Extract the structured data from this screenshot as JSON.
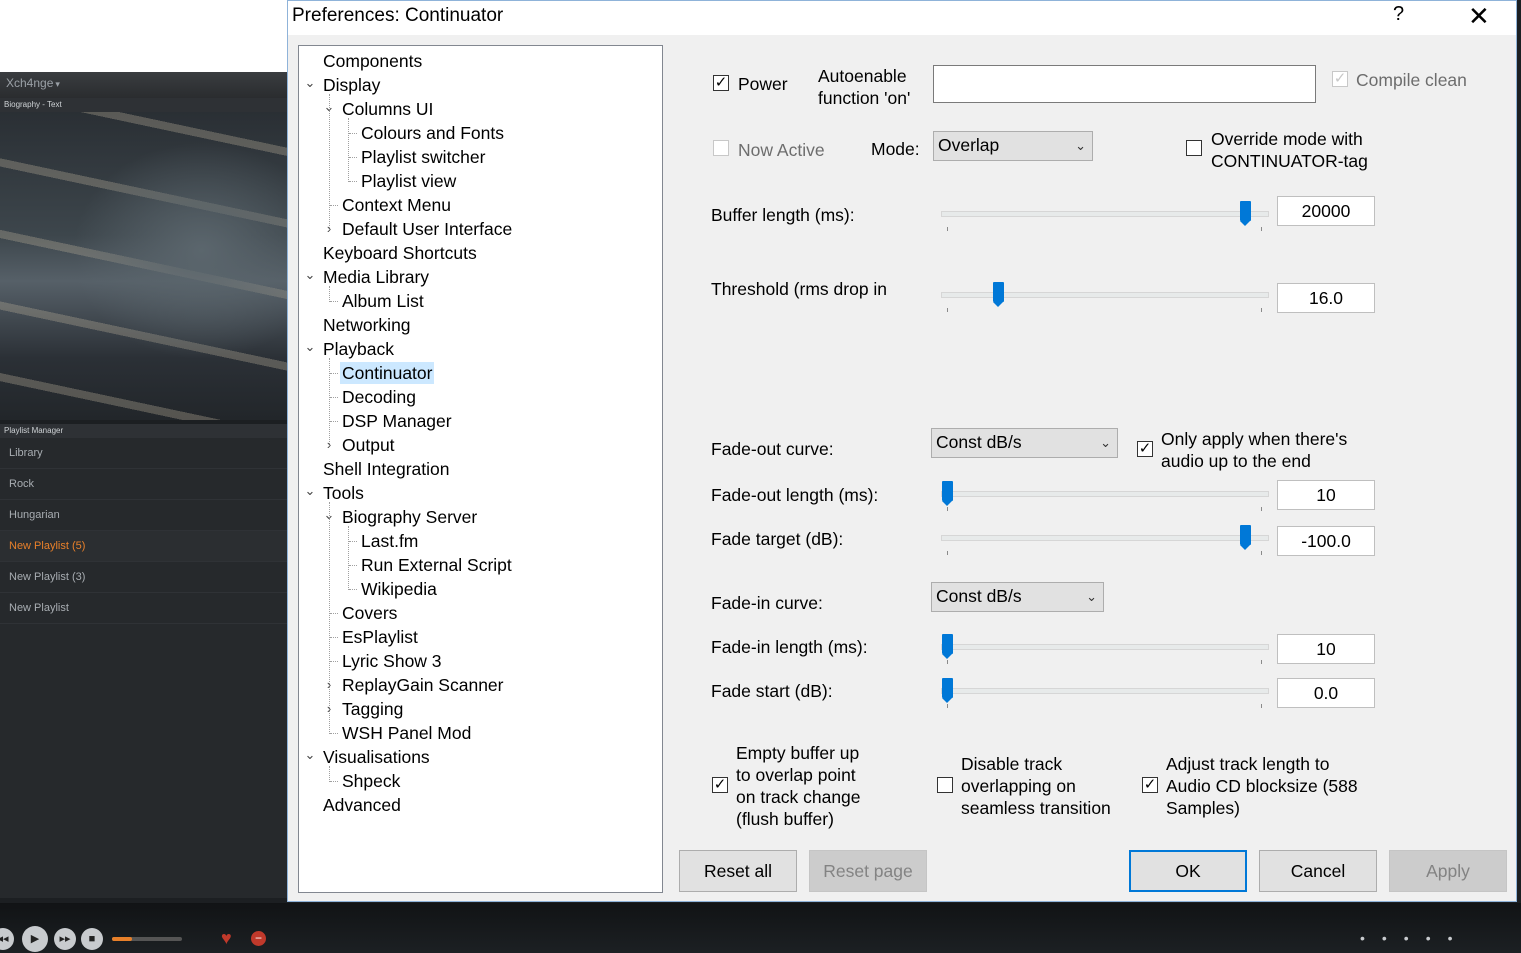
{
  "background": {
    "brand": "Xch4nge",
    "panel_header_top": "Biography - Text",
    "panel_header_mid": "Playlist Manager",
    "playlists": [
      {
        "label": "Library",
        "active": false
      },
      {
        "label": "Rock",
        "active": false
      },
      {
        "label": "Hungarian",
        "active": false
      },
      {
        "label": "New Playlist (5)",
        "active": true
      },
      {
        "label": "New Playlist (3)",
        "active": false
      },
      {
        "label": "New Playlist",
        "active": false
      }
    ],
    "accent": "#e8802a"
  },
  "dialog": {
    "title": "Preferences: Continuator",
    "help": "?",
    "close": "✕"
  },
  "tree": [
    {
      "label": "Components",
      "level": 0,
      "expander": ""
    },
    {
      "label": "Display",
      "level": 0,
      "expander": "open"
    },
    {
      "label": "Columns UI",
      "level": 1,
      "expander": "open"
    },
    {
      "label": "Colours and Fonts",
      "level": 2,
      "expander": ""
    },
    {
      "label": "Playlist switcher",
      "level": 2,
      "expander": ""
    },
    {
      "label": "Playlist view",
      "level": 2,
      "expander": ""
    },
    {
      "label": "Context Menu",
      "level": 1,
      "expander": ""
    },
    {
      "label": "Default User Interface",
      "level": 1,
      "expander": "closed"
    },
    {
      "label": "Keyboard Shortcuts",
      "level": 0,
      "expander": ""
    },
    {
      "label": "Media Library",
      "level": 0,
      "expander": "open"
    },
    {
      "label": "Album List",
      "level": 1,
      "expander": ""
    },
    {
      "label": "Networking",
      "level": 0,
      "expander": ""
    },
    {
      "label": "Playback",
      "level": 0,
      "expander": "open"
    },
    {
      "label": "Continuator",
      "level": 1,
      "expander": "",
      "selected": true
    },
    {
      "label": "Decoding",
      "level": 1,
      "expander": ""
    },
    {
      "label": "DSP Manager",
      "level": 1,
      "expander": ""
    },
    {
      "label": "Output",
      "level": 1,
      "expander": "closed"
    },
    {
      "label": "Shell Integration",
      "level": 0,
      "expander": ""
    },
    {
      "label": "Tools",
      "level": 0,
      "expander": "open"
    },
    {
      "label": "Biography Server",
      "level": 1,
      "expander": "open"
    },
    {
      "label": "Last.fm",
      "level": 2,
      "expander": ""
    },
    {
      "label": "Run External Script",
      "level": 2,
      "expander": ""
    },
    {
      "label": "Wikipedia",
      "level": 2,
      "expander": ""
    },
    {
      "label": "Covers",
      "level": 1,
      "expander": ""
    },
    {
      "label": "EsPlaylist",
      "level": 1,
      "expander": ""
    },
    {
      "label": "Lyric Show 3",
      "level": 1,
      "expander": ""
    },
    {
      "label": "ReplayGain Scanner",
      "level": 1,
      "expander": "closed"
    },
    {
      "label": "Tagging",
      "level": 1,
      "expander": "closed"
    },
    {
      "label": "WSH Panel Mod",
      "level": 1,
      "expander": ""
    },
    {
      "label": "Visualisations",
      "level": 0,
      "expander": "open"
    },
    {
      "label": "Shpeck",
      "level": 1,
      "expander": ""
    },
    {
      "label": "Advanced",
      "level": 0,
      "expander": ""
    }
  ],
  "settings": {
    "power_label": "Power",
    "power_checked": true,
    "autoenable_label_1": "Autoenable",
    "autoenable_label_2": "function 'on'",
    "autoenable_value": "",
    "compile_clean_label": "Compile clean",
    "compile_clean_checked": true,
    "now_active_label": "Now Active",
    "now_active_checked": false,
    "mode_label": "Mode:",
    "mode_value": "Overlap",
    "override_label_1": "Override mode with",
    "override_label_2": "CONTINUATOR-tag",
    "override_checked": false,
    "buffer_label": "Buffer length (ms):",
    "buffer_value": "20000",
    "buffer_level": 1.0,
    "threshold_label": "Threshold (rms drop in",
    "threshold_value": "16.0",
    "threshold_level": 0.17,
    "fadeout_curve_label": "Fade-out curve:",
    "fadeout_curve_value": "Const dB/s",
    "only_apply_label_1": "Only apply when there's",
    "only_apply_label_2": "audio up to the end",
    "only_apply_checked": true,
    "fadeout_length_label": "Fade-out length (ms):",
    "fadeout_length_value": "10",
    "fadeout_length_level": 0.0,
    "fade_target_label": "Fade target (dB):",
    "fade_target_value": "-100.0",
    "fade_target_level": 1.0,
    "fadein_curve_label": "Fade-in curve:",
    "fadein_curve_value": "Const dB/s",
    "fadein_length_label": "Fade-in length (ms):",
    "fadein_length_value": "10",
    "fadein_length_level": 0.0,
    "fade_start_label": "Fade start (dB):",
    "fade_start_value": "0.0",
    "fade_start_level": 0.0,
    "empty_buffer_lines": [
      "Empty buffer up",
      "to overlap point",
      "on track change",
      "(flush buffer)"
    ],
    "empty_buffer_checked": true,
    "disable_track_lines": [
      "Disable track",
      "overlapping on",
      "seamless transition"
    ],
    "disable_track_checked": false,
    "adjust_track_lines": [
      "Adjust track length to",
      "Audio CD blocksize (588",
      "Samples)"
    ],
    "adjust_track_checked": true
  },
  "buttons": {
    "reset_all": "Reset all",
    "reset_page": "Reset page",
    "ok": "OK",
    "cancel": "Cancel",
    "apply": "Apply"
  }
}
